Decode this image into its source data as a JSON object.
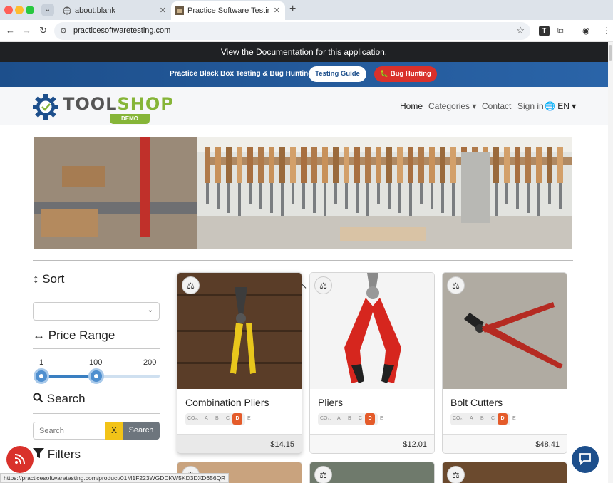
{
  "browser": {
    "tabs": [
      {
        "title": "about:blank",
        "close": "✕"
      },
      {
        "title": "Practice Software Testing - Toolshop",
        "close": "✕"
      }
    ],
    "new_tab": "+",
    "tab_menu": "⌄",
    "url": "practicesoftwaretesting.com",
    "status_url": "https://practicesoftwaretesting.com/product/01M1F223WGDDKW5KD3DXD656QR",
    "extension_label": "T"
  },
  "info_bar": {
    "prefix": "View the ",
    "link": "Documentation",
    "suffix": " for this application."
  },
  "promo": {
    "text": "Practice Black Box Testing & Bug Hunting",
    "guide_button": "Testing Guide",
    "bug_button": "🐛 Bug Hunting"
  },
  "nav": {
    "logo_main": "TOOL",
    "logo_accent": "SHOP",
    "logo_demo": "DEMO",
    "home": "Home",
    "categories": "Categories ▾",
    "contact": "Contact",
    "sign_in": "Sign in",
    "language": "🌐 EN ▾"
  },
  "sidebar": {
    "sort_heading": "↕ Sort",
    "price_heading": "↔ Price Range",
    "range_min": "1",
    "range_mid": "100",
    "range_max": "200",
    "range_low_value": 1,
    "range_high_value": 100,
    "search_heading": "Search",
    "search_placeholder": "Search",
    "clear_button": "X",
    "search_button": "Search",
    "filters_heading": "Filters"
  },
  "co2": {
    "label": "CO₂:",
    "grades": [
      "A",
      "B",
      "C",
      "D",
      "E"
    ],
    "selected": "D"
  },
  "products": [
    {
      "name": "Combination Pliers",
      "price": "$14.15"
    },
    {
      "name": "Pliers",
      "price": "$12.01"
    },
    {
      "name": "Bolt Cutters",
      "price": "$48.41"
    }
  ],
  "colors": {
    "brand_blue": "#1d4f8c",
    "accent_green": "#86b538",
    "bug_red": "#d9312b",
    "co2_selected": "#e45b2a"
  }
}
